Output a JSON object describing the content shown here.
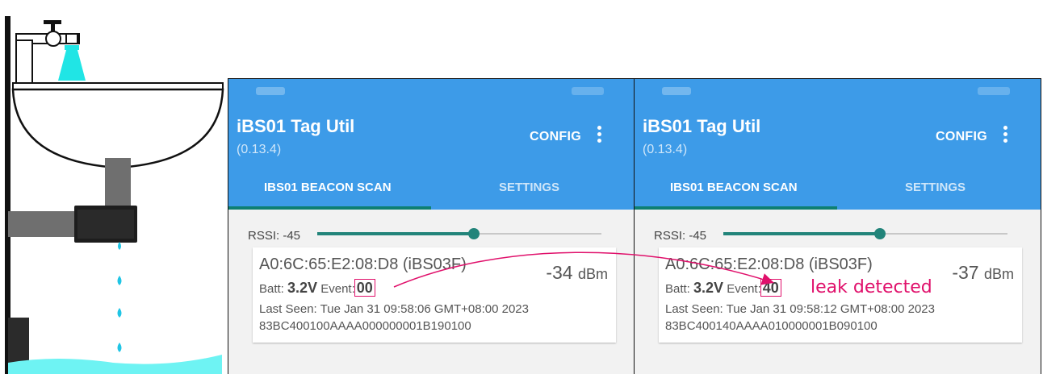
{
  "colors": {
    "appbar": "#3d9be8",
    "accent": "#22847a",
    "highlight": "#e0106b",
    "water": "#6ef3f3"
  },
  "screens": [
    {
      "title": "iBS01 Tag Util",
      "version": "(0.13.4)",
      "config": "CONFIG",
      "menu_icon": "more-vert-icon",
      "tabs": [
        "IBS01 BEACON SCAN",
        "SETTINGS"
      ],
      "active_tab": "IBS01 BEACON SCAN",
      "rssi_label": "RSSI: -45",
      "rssi_slider_fraction": 0.55,
      "device": {
        "name": "A0:6C:65:E2:08:D8 (iBS03F)",
        "rssi_value": "-34",
        "rssi_unit": "dBm",
        "batt_label": "Batt:",
        "batt_value": "3.2V",
        "event_label": "Event:",
        "event_value": "00",
        "last_seen": "Last Seen: Tue Jan 31 09:58:06 GMT+08:00 2023",
        "raw": "83BC400100AAAA000000001B190100"
      }
    },
    {
      "title": "iBS01 Tag Util",
      "version": "(0.13.4)",
      "config": "CONFIG",
      "menu_icon": "more-vert-icon",
      "tabs": [
        "IBS01 BEACON SCAN",
        "SETTINGS"
      ],
      "active_tab": "IBS01 BEACON SCAN",
      "rssi_label": "RSSI: -45",
      "rssi_slider_fraction": 0.55,
      "device": {
        "name": "A0:6C:65:E2:08:D8 (iBS03F)",
        "rssi_value": "-37",
        "rssi_unit": "dBm",
        "batt_label": "Batt:",
        "batt_value": "3.2V",
        "event_label": "Event:",
        "event_value": "40",
        "last_seen": "Last Seen: Tue Jan 31 09:58:12 GMT+08:00 2023",
        "raw": "83BC400140AAAA010000001B090100"
      }
    }
  ],
  "annotation": {
    "leak_text": "leak detected"
  }
}
